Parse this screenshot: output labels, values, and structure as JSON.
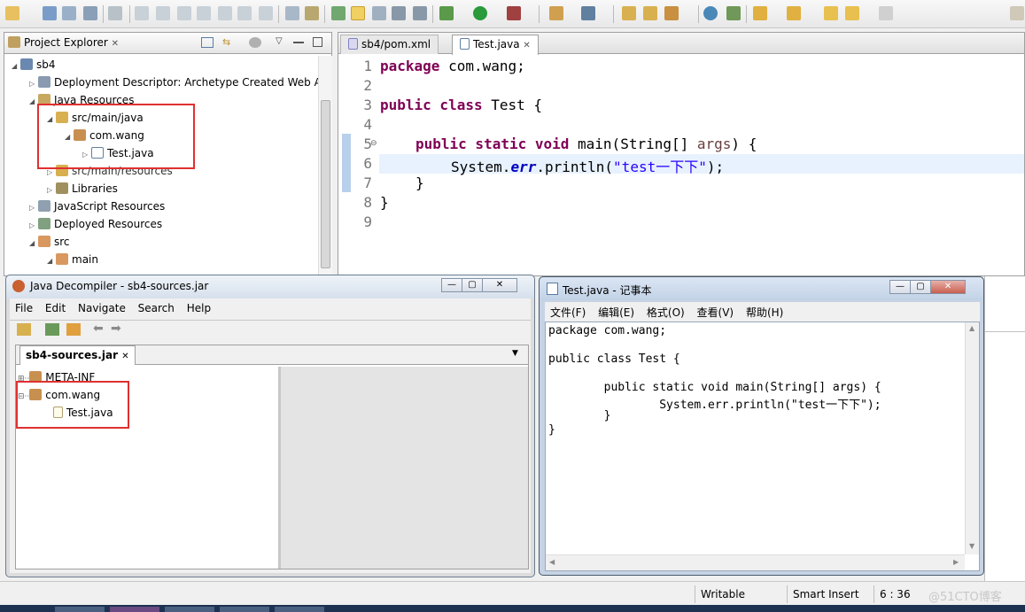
{
  "project_explorer": {
    "title": "Project Explorer",
    "tree": [
      {
        "label": "sb4"
      },
      {
        "label": "Deployment Descriptor: Archetype Created Web A"
      },
      {
        "label": "Java Resources"
      },
      {
        "label": "src/main/java"
      },
      {
        "label": "com.wang"
      },
      {
        "label": "Test.java"
      },
      {
        "label": "src/main/resources"
      },
      {
        "label": "Libraries"
      },
      {
        "label": "JavaScript Resources"
      },
      {
        "label": "Deployed Resources"
      },
      {
        "label": "src"
      },
      {
        "label": "main"
      }
    ]
  },
  "editor": {
    "tabs": [
      {
        "label": "sb4/pom.xml"
      },
      {
        "label": "Test.java"
      }
    ],
    "line_numbers": [
      "1",
      "2",
      "3",
      "4",
      "5",
      "6",
      "7",
      "8",
      "9"
    ],
    "code": {
      "l1_kw": "package",
      "l1_rest": " com.wang;",
      "l3_kw": "public class",
      "l3_rest": " Test {",
      "l5_kw": "public static void",
      "l5_a": " main(String[] ",
      "l5_param": "args",
      "l5_b": ") {",
      "l6_a": "System.",
      "l6_field": "err",
      "l6_b": ".println(",
      "l6_str": "\"test一下下\"",
      "l6_c": ");",
      "l7": "}",
      "l8": "}"
    }
  },
  "decompiler": {
    "title": "Java Decompiler - sb4-sources.jar",
    "menu": [
      "File",
      "Edit",
      "Navigate",
      "Search",
      "Help"
    ],
    "tab": "sb4-sources.jar",
    "tree": [
      {
        "label": "META-INF"
      },
      {
        "label": "com.wang"
      },
      {
        "label": "Test.java"
      }
    ]
  },
  "notepad": {
    "title": "Test.java - 记事本",
    "menu": [
      "文件(F)",
      "编辑(E)",
      "格式(O)",
      "查看(V)",
      "帮助(H)"
    ],
    "lines": [
      "package com.wang;",
      "",
      "public class Test {",
      "",
      "        public static void main(String[] args) {",
      "                System.err.println(\"test一下下\");",
      "        }",
      "}"
    ]
  },
  "statusbar": {
    "writable": "Writable",
    "insert_mode": "Smart Insert",
    "position": "6 : 36",
    "watermark": "@51CTO博客"
  },
  "colors": {
    "keyword": "#7f0055",
    "string": "#2a00ff",
    "highlight": "#e8f2fe",
    "annotation_box": "#e03030"
  }
}
